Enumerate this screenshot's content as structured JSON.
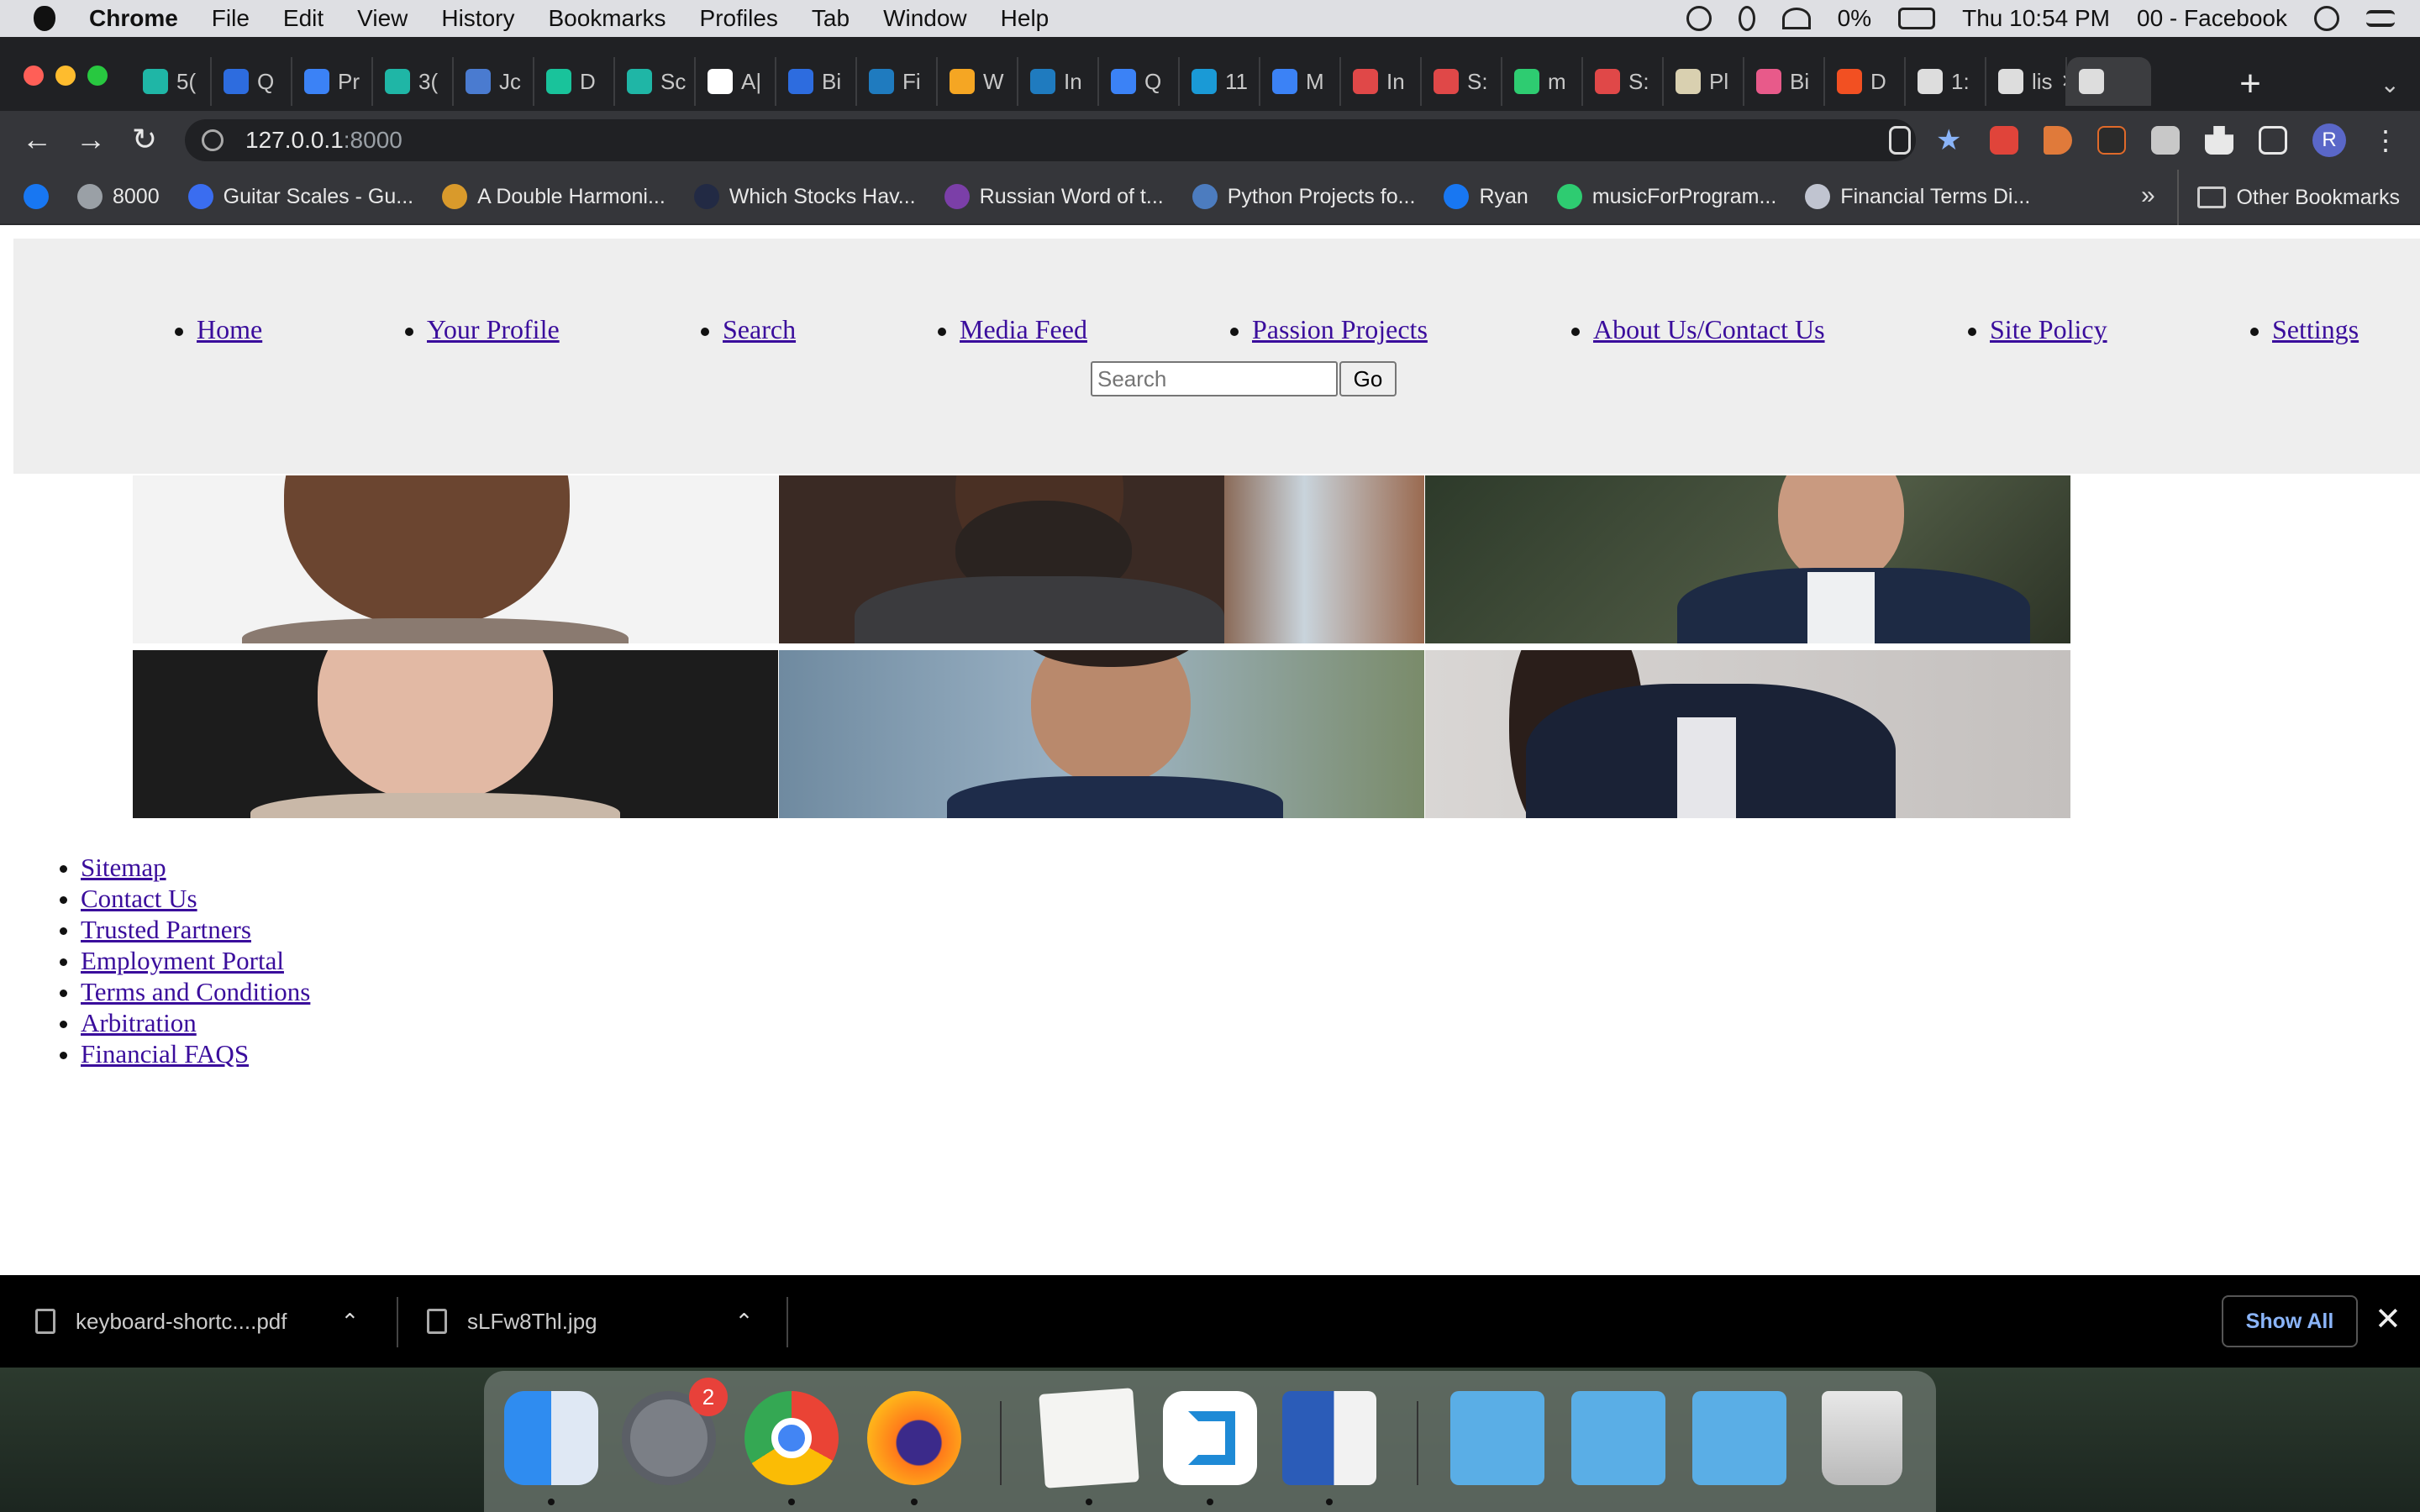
{
  "menubar": {
    "app": "Chrome",
    "items": [
      "File",
      "Edit",
      "View",
      "History",
      "Bookmarks",
      "Profiles",
      "Tab",
      "Window",
      "Help"
    ],
    "battery": "0%",
    "clock": "Thu 10:54 PM",
    "window_title": "00 - Facebook"
  },
  "tabs": [
    {
      "label": "5(",
      "color": "#1fb6a6"
    },
    {
      "label": "Q",
      "color": "#2d6cdf"
    },
    {
      "label": "Pr",
      "color": "#3b82f6"
    },
    {
      "label": "3(",
      "color": "#1fb6a6"
    },
    {
      "label": "Jc",
      "color": "#4a7bd0"
    },
    {
      "label": "D",
      "color": "#19c39b"
    },
    {
      "label": "Sc",
      "color": "#1fb6a6"
    },
    {
      "label": "A|",
      "color": "#ffffff"
    },
    {
      "label": "Bi",
      "color": "#2d6cdf"
    },
    {
      "label": "Fi",
      "color": "#1f7bbf"
    },
    {
      "label": "W",
      "color": "#f5a623"
    },
    {
      "label": "In",
      "color": "#1f7bbf"
    },
    {
      "label": "Q",
      "color": "#3b82f6"
    },
    {
      "label": "11",
      "color": "#1a9ad6"
    },
    {
      "label": "M",
      "color": "#3b82f6"
    },
    {
      "label": "In",
      "color": "#e04848"
    },
    {
      "label": "S:",
      "color": "#e04848"
    },
    {
      "label": "m",
      "color": "#2ecc71"
    },
    {
      "label": "S:",
      "color": "#e04848"
    },
    {
      "label": "Pl",
      "color": "#d9d0b0"
    },
    {
      "label": "Bi",
      "color": "#e85a8a"
    },
    {
      "label": "D",
      "color": "#f25022"
    },
    {
      "label": "1:",
      "color": "#dddddd"
    },
    {
      "label": "lis",
      "color": "#dddddd"
    },
    {
      "label": "",
      "color": "#dddddd"
    }
  ],
  "address": {
    "host": "127.0.0.1",
    "port": ":8000"
  },
  "bookmarks": [
    {
      "label": "",
      "color": "#1877f2"
    },
    {
      "label": "8000",
      "color": "#9aa0a6"
    },
    {
      "label": "Guitar Scales - Gu...",
      "color": "#3a6df0"
    },
    {
      "label": "A Double Harmoni...",
      "color": "#d99a2b"
    },
    {
      "label": "Which Stocks Hav...",
      "color": "#222a44"
    },
    {
      "label": "Russian Word of t...",
      "color": "#7b3fa8"
    },
    {
      "label": "Python Projects fo...",
      "color": "#4c7cbf"
    },
    {
      "label": "Ryan",
      "color": "#1877f2"
    },
    {
      "label": "musicForProgram...",
      "color": "#2ecc71"
    },
    {
      "label": "Financial Terms Di...",
      "color": "#c0c4d0"
    }
  ],
  "bookmarks_more": "»",
  "other_bookmarks": "Other Bookmarks",
  "site": {
    "nav": [
      "Home",
      "Your Profile",
      "Search",
      "Media Feed",
      "Passion Projects",
      "About Us/Contact Us",
      "Site Policy",
      "Settings"
    ],
    "search_placeholder": "Search",
    "go_label": "Go",
    "footer_links": [
      "Sitemap",
      "Contact Us",
      "Trusted Partners",
      "Employment Portal",
      "Terms and Conditions",
      "Arbitration",
      "Financial FAQS"
    ]
  },
  "downloads": {
    "files": [
      "keyboard-shortc....pdf",
      "sLFw8Thl.jpg"
    ],
    "show_all": "Show All",
    "close": "✕"
  },
  "dock": {
    "apps": [
      "finder",
      "system-preferences",
      "chrome",
      "firefox",
      "textedit",
      "vscode",
      "word",
      "applications-folder",
      "documents-folder",
      "downloads-folder",
      "trash"
    ],
    "settings_badge": "2"
  }
}
